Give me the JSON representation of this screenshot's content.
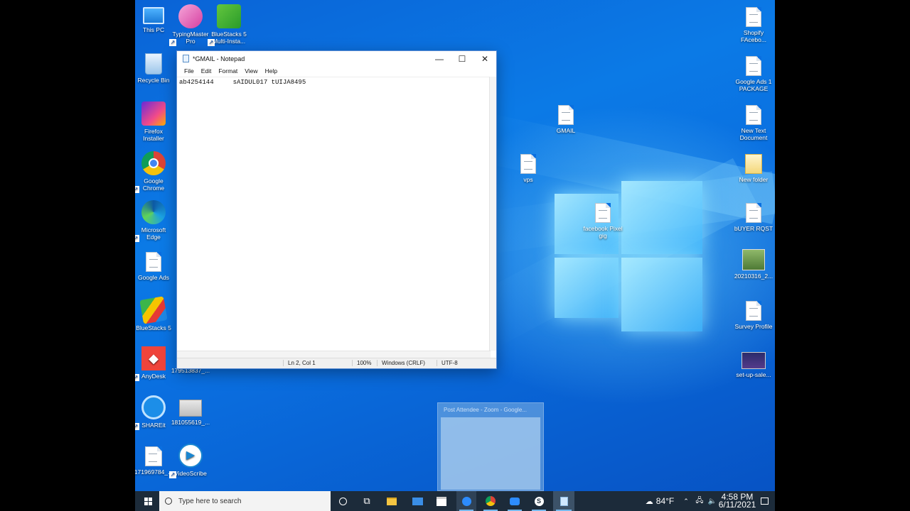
{
  "desktop": {
    "left_icons": [
      {
        "label": "This PC"
      },
      {
        "label": "Recycle Bin"
      },
      {
        "label": "Firefox Installer"
      },
      {
        "label": "Google Chrome"
      },
      {
        "label": "Microsoft Edge"
      },
      {
        "label": "Google Ads"
      },
      {
        "label": "BlueStacks 5"
      },
      {
        "label": "AnyDesk"
      },
      {
        "label": "SHAREit"
      },
      {
        "label": "171969784_..."
      }
    ],
    "second_col_icons": [
      {
        "label": "TypingMaster Pro"
      },
      {
        "label": "179513837_..."
      },
      {
        "label": "181055619_..."
      },
      {
        "label": "VideoScribe"
      }
    ],
    "third_col_icons": [
      {
        "label": "BlueStacks 5 Multi-Insta..."
      }
    ],
    "center_icons": [
      {
        "label": "GMAIL"
      },
      {
        "label": "vps"
      },
      {
        "label": "facebook Pixel gig"
      }
    ],
    "right_icons": [
      {
        "label": "Shopify FAcebo..."
      },
      {
        "label": "Google Ads 1 PACKAGE"
      },
      {
        "label": "New Text Document"
      },
      {
        "label": "New folder"
      },
      {
        "label": "bUYER RQST"
      },
      {
        "label": "20210316_2..."
      },
      {
        "label": "Survey Profile"
      },
      {
        "label": "set-up-sale..."
      }
    ]
  },
  "notepad": {
    "title": "*GMAIL - Notepad",
    "menu": [
      "File",
      "Edit",
      "Format",
      "View",
      "Help"
    ],
    "content": "ab4254144     sAIDUL017 tUIJA8495",
    "status": {
      "position": "Ln 2, Col 1",
      "zoom": "100%",
      "line_ending": "Windows (CRLF)",
      "encoding": "UTF-8"
    }
  },
  "zoom_preview": {
    "title": "Post Attendee - Zoom - Google..."
  },
  "taskbar": {
    "search_placeholder": "Type here to search",
    "weather": "84°F",
    "time": "4:58 PM",
    "date": "6/11/2021"
  }
}
